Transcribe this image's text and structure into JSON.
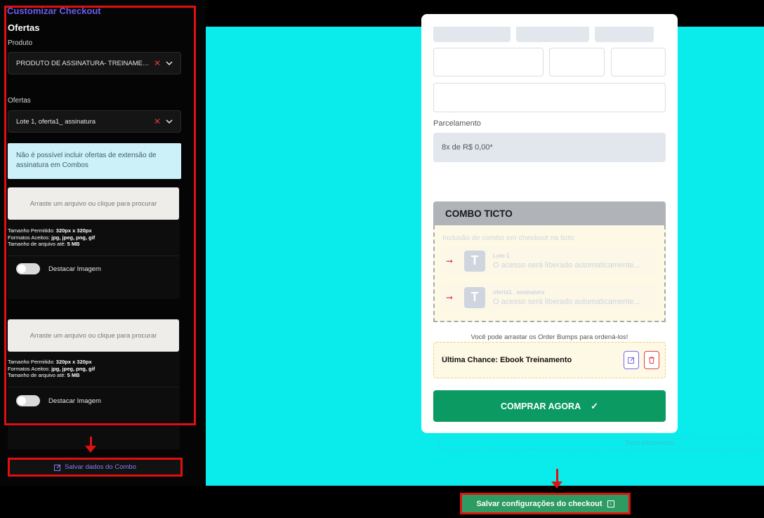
{
  "sidebar": {
    "title": "Customizar Checkout",
    "section": "Ofertas",
    "produto_label": "Produto",
    "produto_value": "PRODUTO DE ASSINATURA- TREINAMENTO...",
    "ofertas_label": "Ofertas",
    "ofertas_value": "Lote 1, oferta1_ assinatura",
    "info": "Não é possível incluir ofertas de extensão de assinatura em Combos",
    "uploads": [
      {
        "placeholder": "Arraste um arquivo ou clique para procurar",
        "size_label": "Tamanho Permitido:",
        "size_value": "320px x 320px",
        "formats_label": "Formatos Aceitos:",
        "formats_value": "jpg, jpeg, png, gif",
        "filesize_label": "Tamanho de arquivo até:",
        "filesize_value": "5 MB",
        "toggle_label": "Destacar Imagem",
        "toggle_on": false
      },
      {
        "placeholder": "Arraste um arquivo ou clique para procurar",
        "size_label": "Tamanho Permitido:",
        "size_value": "320px x 320px",
        "formats_label": "Formatos Aceitos:",
        "formats_value": "jpg, jpeg, png, gif",
        "filesize_label": "Tamanho de arquivo até:",
        "filesize_value": "5 MB",
        "toggle_label": "Destacar Imagem",
        "toggle_on": false
      }
    ],
    "save_combo": "Salvar dados do Combo"
  },
  "preview": {
    "parcelamento_label": "Parcelamento",
    "parcelamento_value": "8x de R$ 0,00*",
    "combo": {
      "title": "COMBO TICTO",
      "description": "Inclusão de combo em checkout na ticto",
      "offers": [
        {
          "title": "Lote 1",
          "subtitle": "O acesso será liberado automaticamente...",
          "logo": "T"
        },
        {
          "title": "oferta1_ assinatura",
          "subtitle": "O acesso será liberado automaticamente...",
          "logo": "T"
        }
      ]
    },
    "order_bump_hint": "Você pode arrastar os Order Bumps para ordená-los!",
    "order_bump": "Última Chance: Ebook Treinamento",
    "buy_button": "COMPRAR AGORA",
    "empty_zone": "Sem elementos"
  },
  "footer": {
    "save_checkout": "Salvar configurações do checkout"
  },
  "colors": {
    "accent_purple": "#6f5cf0",
    "canvas": "#0aeceb",
    "buy_green": "#0b9a61",
    "highlight_red": "#e01010"
  },
  "icons": {
    "select_clear": "close-icon",
    "select_open": "chevron-down-icon",
    "save_combo": "edit-icon",
    "bump_edit": "edit-icon",
    "bump_delete": "trash-icon",
    "buy": "check-icon",
    "save_checkout": "save-icon"
  }
}
